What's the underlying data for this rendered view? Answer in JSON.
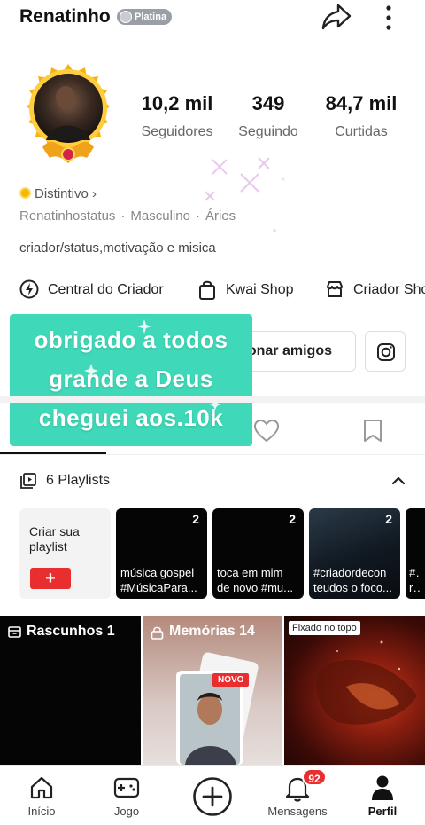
{
  "header": {
    "username": "Renatinho",
    "level_badge": "Platina",
    "icons": {
      "share": "share-arrow-icon",
      "more": "more-vertical-icon"
    }
  },
  "profile": {
    "avatar": "avatar-with-gold-frame",
    "stats": [
      {
        "value": "10,2 mil",
        "label": "Seguidores"
      },
      {
        "value": "349",
        "label": "Seguindo"
      },
      {
        "value": "84,7 mil",
        "label": "Curtidas"
      }
    ],
    "distintivo": "Distintivo",
    "meta": {
      "handle": "Renatinhostatus",
      "gender": "Masculino",
      "sign": "Áries",
      "separator": "·"
    },
    "bio": "criador/status,motivação e misica"
  },
  "shortcuts": [
    {
      "label": "Central do Criador",
      "icon": "lightning-icon"
    },
    {
      "label": "Kwai Shop",
      "icon": "shopping-bag-icon"
    },
    {
      "label": "Criador Sho",
      "icon": "store-icon"
    }
  ],
  "actions": {
    "add_friends": "onar amigos",
    "instagram_icon": "instagram-icon"
  },
  "overlay": {
    "lines": [
      "obrigado a todos",
      "grande a Deus",
      "cheguei aos.10k"
    ],
    "color": "#3fd8b8"
  },
  "tabs": [
    {
      "name": "videos",
      "icon": "grid-icon",
      "active": true
    },
    {
      "name": "likes",
      "icon": "heart-icon",
      "active": false
    },
    {
      "name": "saved",
      "icon": "bookmark-icon",
      "active": false
    }
  ],
  "playlists": {
    "header": "6 Playlists",
    "create_label": "Criar sua playlist",
    "plus": "+",
    "items": [
      {
        "count": "2",
        "title": "música gospel #MúsicaPara...",
        "line1": "música gospel",
        "line2": "#MúsicaPara..."
      },
      {
        "count": "2",
        "line1": "toca em mim",
        "line2": "de novo #mu..."
      },
      {
        "count": "2",
        "line1": "#criadordecon",
        "line2": "teudos o foco..."
      },
      {
        "count": "",
        "line1": "#A",
        "line2": "rilh"
      }
    ]
  },
  "grid": {
    "drafts": "Rascunhos 1",
    "memories": "Memórias 14",
    "new_tag": "NOVO",
    "pinned_tag": "Fixado no topo"
  },
  "bottom_nav": [
    {
      "label": "Início",
      "icon": "home-icon"
    },
    {
      "label": "Jogo",
      "icon": "gamepad-icon"
    },
    {
      "label": "",
      "icon": "plus-circle-icon"
    },
    {
      "label": "Mensagens",
      "icon": "bell-icon",
      "badge": "92"
    },
    {
      "label": "Perfil",
      "icon": "person-icon",
      "active": true
    }
  ],
  "colors": {
    "accent_red": "#e82e2e",
    "overlay_teal": "#3fd8b8",
    "badge_grey": "#9a9fa7"
  }
}
